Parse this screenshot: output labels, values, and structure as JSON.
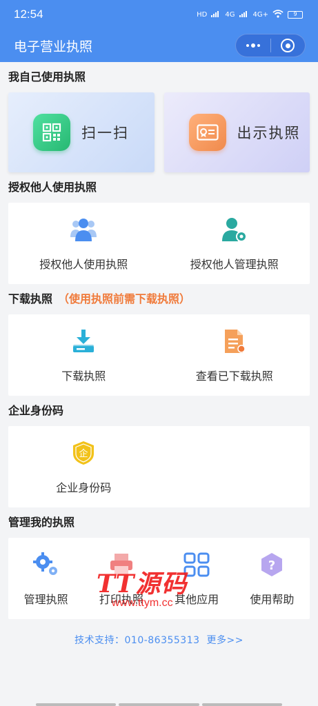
{
  "status_bar": {
    "time": "12:54",
    "network_1": "HD",
    "network_2": "4G",
    "network_3": "4G+",
    "battery": "9"
  },
  "nav": {
    "title": "电子营业执照",
    "more_icon": "dots-icon",
    "close_icon": "target-icon"
  },
  "sections": {
    "self_use": {
      "title": "我自己使用执照",
      "scan_label": "扫一扫",
      "show_label": "出示执照"
    },
    "authorize": {
      "title": "授权他人使用执照",
      "items": [
        {
          "label": "授权他人使用执照",
          "icon": "users-icon"
        },
        {
          "label": "授权他人管理执照",
          "icon": "user-gear-icon"
        }
      ]
    },
    "download": {
      "title": "下载执照",
      "note": "（使用执照前需下载执照）",
      "items": [
        {
          "label": "下载执照",
          "icon": "download-icon"
        },
        {
          "label": "查看已下载执照",
          "icon": "document-icon"
        }
      ]
    },
    "enterprise_id": {
      "title": "企业身份码",
      "items": [
        {
          "label": "企业身份码",
          "icon": "shield-badge-icon",
          "badge_char": "企"
        }
      ]
    },
    "manage": {
      "title": "管理我的执照",
      "items": [
        {
          "label": "管理执照",
          "icon": "gears-icon"
        },
        {
          "label": "打印执照",
          "icon": "printer-icon"
        },
        {
          "label": "其他应用",
          "icon": "apps-grid-icon"
        },
        {
          "label": "使用帮助",
          "icon": "help-icon"
        }
      ]
    }
  },
  "footer": {
    "support": "技术支持：010-86355313",
    "more": "更多>>"
  },
  "watermark": {
    "big": "TT源码",
    "small": "www.ttym.cc"
  },
  "colors": {
    "brand": "#4b8ef0",
    "note": "#f07a3a",
    "watermark": "#f02020"
  }
}
